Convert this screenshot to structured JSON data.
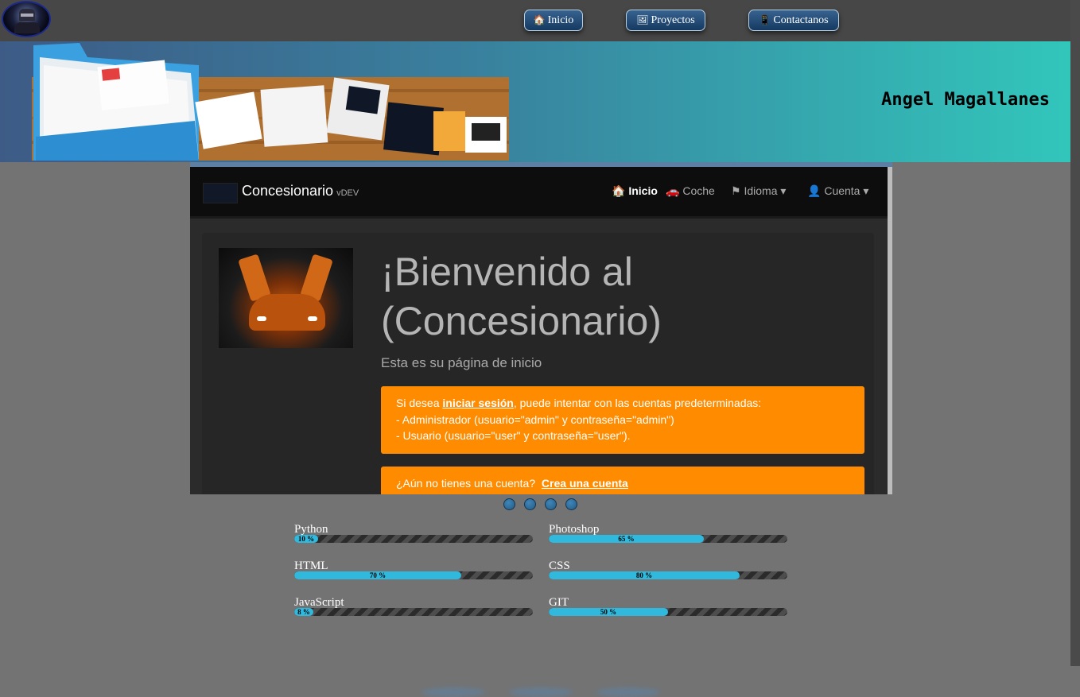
{
  "nav": {
    "items": [
      {
        "label": "Inicio",
        "icon": "house-icon"
      },
      {
        "label": "Proyectos",
        "icon": "picture-icon"
      },
      {
        "label": "Contactanos",
        "icon": "phone-icon"
      }
    ]
  },
  "banner": {
    "author": "Angel Magallanes"
  },
  "slide": {
    "brand": "Concesionario",
    "brand_version": "vDEV",
    "nav": [
      "Inicio",
      "Coche",
      "Idioma",
      "Cuenta"
    ],
    "heading_line1": "¡Bienvenido al",
    "heading_line2": "(Concesionario)",
    "subtitle": "Esta es su página de inicio",
    "alert1_pre": "Si desea ",
    "alert1_link": "iniciar sesión",
    "alert1_post": ", puede intentar con las cuentas predeterminadas:",
    "alert1_line2": "- Administrador (usuario=\"admin\" y contraseña=\"admin\")",
    "alert1_line3": "- Usuario (usuario=\"user\" y contraseña=\"user\").",
    "alert2_pre": "¿Aún no tienes una cuenta?",
    "alert2_link": "Crea una cuenta"
  },
  "carousel": {
    "dots": 4
  },
  "skills": [
    {
      "name": "Python",
      "percent": 10,
      "label": "10 %"
    },
    {
      "name": "Photoshop",
      "percent": 65,
      "label": "65 %"
    },
    {
      "name": "HTML",
      "percent": 70,
      "label": "70 %"
    },
    {
      "name": "CSS",
      "percent": 80,
      "label": "80 %"
    },
    {
      "name": "JavaScript",
      "percent": 8,
      "label": "8 %"
    },
    {
      "name": "GIT",
      "percent": 50,
      "label": "50 %"
    }
  ],
  "colors": {
    "accent": "#31b9dd",
    "alert": "#ff8c00",
    "nav_button": "#1f4a75"
  }
}
